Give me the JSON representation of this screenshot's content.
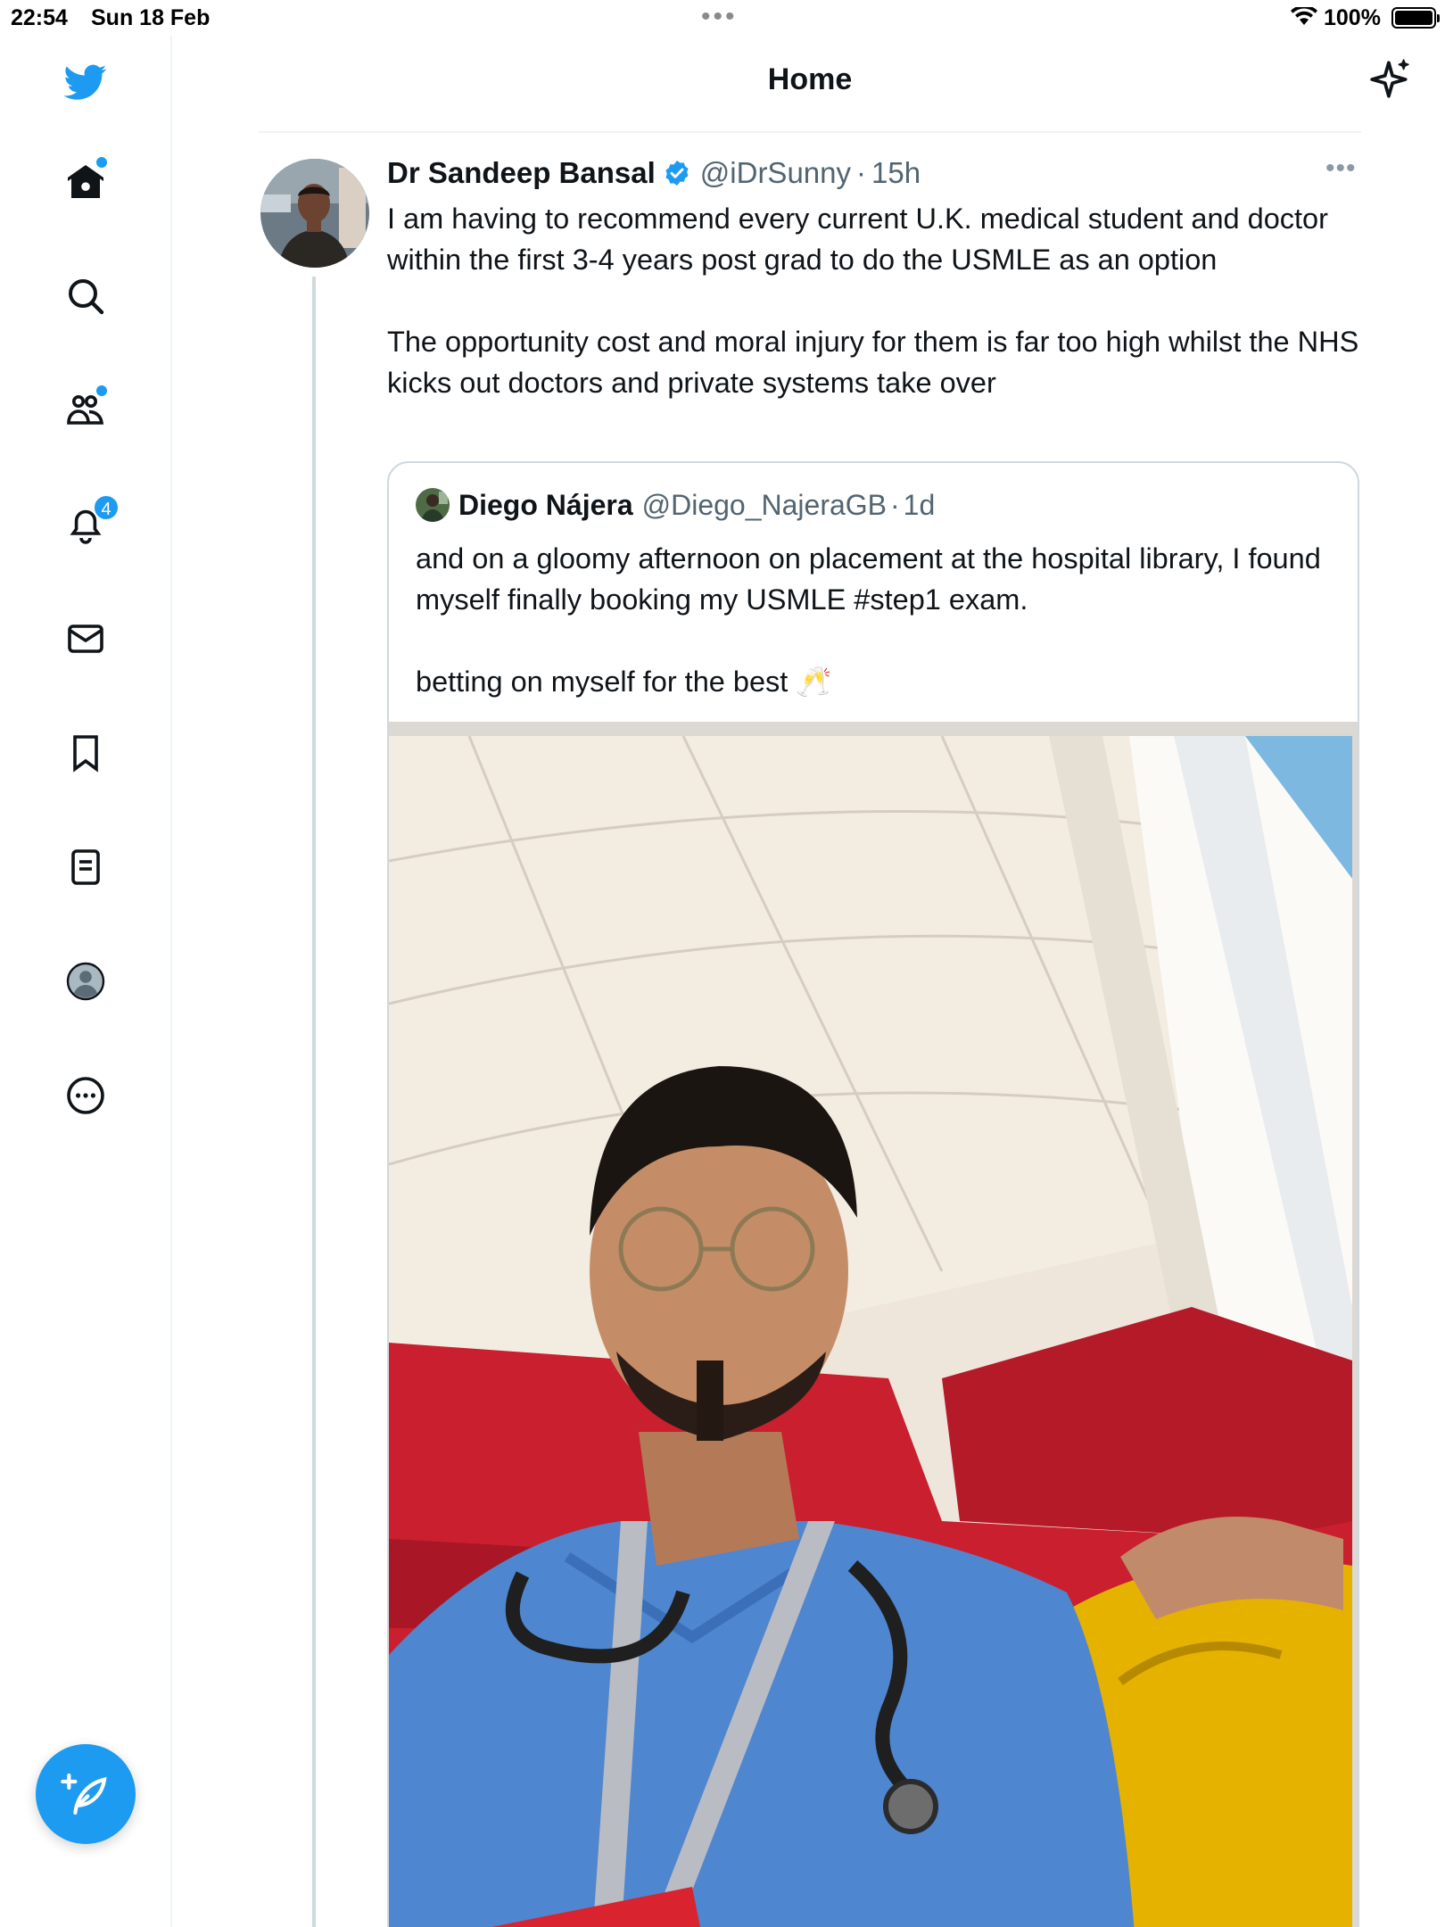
{
  "status_bar": {
    "time": "22:54",
    "date": "Sun 18 Feb",
    "battery": "100%"
  },
  "sidebar": {
    "items": [
      {
        "name": "home-icon"
      },
      {
        "name": "search-icon"
      },
      {
        "name": "communities-icon"
      },
      {
        "name": "notifications-icon",
        "badge": "4"
      },
      {
        "name": "messages-icon"
      },
      {
        "name": "bookmarks-icon"
      },
      {
        "name": "lists-icon"
      },
      {
        "name": "profile-icon"
      },
      {
        "name": "more-icon"
      }
    ],
    "accent_color": "#1d9bf0"
  },
  "header": {
    "title": "Home"
  },
  "tweet": {
    "author_name": "Dr Sandeep Bansal",
    "handle": "@iDrSunny",
    "separator": "·",
    "time": "15h",
    "paragraph_1": "I am having to recommend every current U.K. medical student and doctor within the first 3-4 years post grad to do the USMLE as an option",
    "paragraph_2": "The opportunity cost and moral injury for them is far too high whilst the NHS kicks out doctors and private systems take over",
    "quote": {
      "author_name": "Diego Nájera",
      "handle": "@Diego_NajeraGB",
      "separator": "·",
      "time": "1d",
      "paragraph_1": "and on a gloomy afternoon on placement at the hospital library, I found myself finally booking my USMLE #step1 exam.",
      "paragraph_2": "betting on myself for the best 🥂"
    }
  }
}
